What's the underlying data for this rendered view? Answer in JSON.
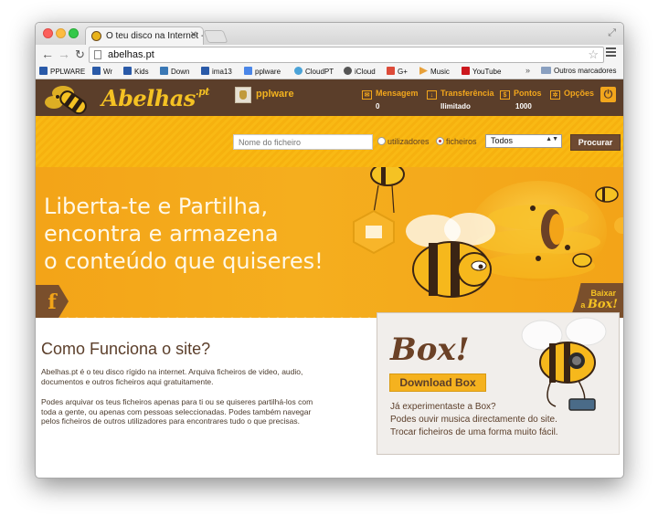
{
  "browser": {
    "tab_title": "O teu disco na Internet - A",
    "url": "abelhas.pt",
    "bookmarks": [
      {
        "label": "PPLWARE",
        "color": "#2a5aa8"
      },
      {
        "label": "Wr",
        "color": "#2a5aa8"
      },
      {
        "label": "Kids",
        "color": "#2a5aa8"
      },
      {
        "label": "Down",
        "color": "#3a78b5"
      },
      {
        "label": "ima13",
        "color": "#2a5aa8"
      },
      {
        "label": "pplware",
        "color": "#4a86e8"
      },
      {
        "label": "CloudPT",
        "color": "#4aa3d8"
      },
      {
        "label": "iCloud",
        "color": "#555555"
      },
      {
        "label": "G+",
        "color": "#dd4b39"
      },
      {
        "label": "Music",
        "color": "#e8a13a"
      },
      {
        "label": "YouTube",
        "color": "#cc181e"
      }
    ],
    "more_bookmarks": "»",
    "other_bookmarks": "Outros marcadores"
  },
  "header": {
    "logo_text": "Abelhas",
    "logo_suffix": ".pt",
    "user_name": "pplware",
    "items": [
      {
        "label": "Mensagem",
        "value": "0",
        "icon": "envelope-icon"
      },
      {
        "label": "Transferência",
        "value": "Ilimitado",
        "icon": "download-icon"
      },
      {
        "label": "Pontos",
        "value": "1000",
        "icon": "points-icon"
      },
      {
        "label": "Opções",
        "value": "",
        "icon": "gear-icon"
      }
    ]
  },
  "search": {
    "placeholder": "Nome do ficheiro",
    "radio_users": "utilizadores",
    "radio_files": "ficheiros",
    "select_value": "Todos",
    "button": "Procurar"
  },
  "banner": {
    "line1": "Liberta-te e Partilha,",
    "line2": "encontra e armazena",
    "line3": "o conteúdo que quiseres!",
    "fb": "f",
    "download_line1": "Baixar",
    "download_line2_a": "a",
    "download_line2_b": "Box!"
  },
  "how": {
    "title": "Como Funciona o site?",
    "p1": "Abelhas.pt é o teu disco rígido na internet. Arquiva ficheiros de video, audio, documentos e outros ficheiros aqui gratuitamente.",
    "p2": "Podes arquivar os teus ficheiros apenas para ti ou se quiseres partilhá-los com toda a gente, ou apenas com pessoas seleccionadas. Podes também navegar pelos ficheiros de outros utilizadores para encontrares tudo o que precisas."
  },
  "box": {
    "title": "Box!",
    "button": "Download Box",
    "line1": "Já experimentaste a Box?",
    "line2": "Podes ouvir musica directamente do site.",
    "line3": "Trocar ficheiros de uma forma muito fácil."
  },
  "colors": {
    "brand_brown": "#5b3e2a",
    "brand_yellow": "#f5c223",
    "banner_orange": "#f3a418"
  }
}
